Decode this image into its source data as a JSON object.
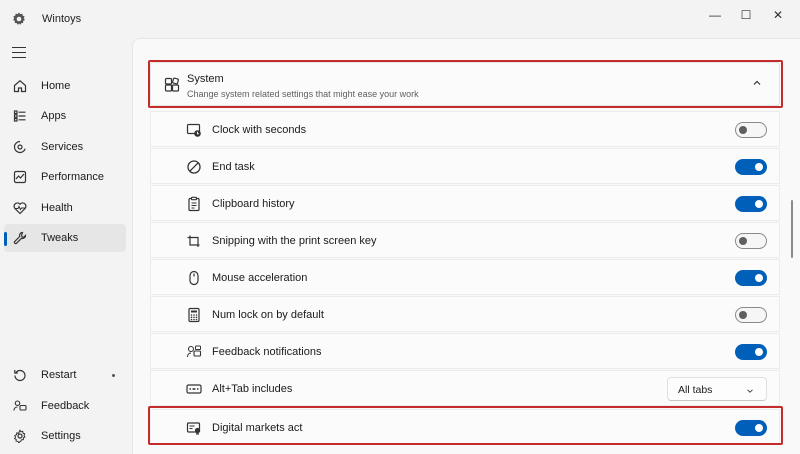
{
  "window": {
    "title": "Wintoys",
    "controls": {
      "minimize": "—",
      "maximize": "☐",
      "close": "✕"
    }
  },
  "nav": {
    "items": [
      {
        "label": "Home",
        "icon": "home-icon"
      },
      {
        "label": "Apps",
        "icon": "apps-list-icon"
      },
      {
        "label": "Services",
        "icon": "services-icon"
      },
      {
        "label": "Performance",
        "icon": "performance-icon"
      },
      {
        "label": "Health",
        "icon": "health-icon"
      },
      {
        "label": "Tweaks",
        "icon": "wrench-icon",
        "active": true
      }
    ],
    "footer": [
      {
        "label": "Restart",
        "icon": "restart-icon"
      },
      {
        "label": "Feedback",
        "icon": "feedback-icon"
      },
      {
        "label": "Settings",
        "icon": "gear-icon"
      }
    ]
  },
  "section": {
    "title": "System",
    "description": "Change system related settings that might ease your work",
    "expanded": true
  },
  "settings": [
    {
      "label": "Clock with seconds",
      "icon": "clock-icon",
      "control": "toggle",
      "on": false
    },
    {
      "label": "End task",
      "icon": "no-entry-icon",
      "control": "toggle",
      "on": true
    },
    {
      "label": "Clipboard history",
      "icon": "clipboard-icon",
      "control": "toggle",
      "on": true
    },
    {
      "label": "Snipping with the print screen key",
      "icon": "snip-icon",
      "control": "toggle",
      "on": false
    },
    {
      "label": "Mouse acceleration",
      "icon": "mouse-icon",
      "control": "toggle",
      "on": true
    },
    {
      "label": "Num lock on by default",
      "icon": "numpad-icon",
      "control": "toggle",
      "on": false
    },
    {
      "label": "Feedback notifications",
      "icon": "feedback-notify-icon",
      "control": "toggle",
      "on": true
    },
    {
      "label": "Alt+Tab includes",
      "icon": "alt-tab-icon",
      "control": "dropdown",
      "value": "All tabs"
    },
    {
      "label": "Digital markets act",
      "icon": "certificate-icon",
      "control": "toggle",
      "on": true
    }
  ],
  "colors": {
    "accent": "#005fb8",
    "highlight": "#c42b2b"
  }
}
